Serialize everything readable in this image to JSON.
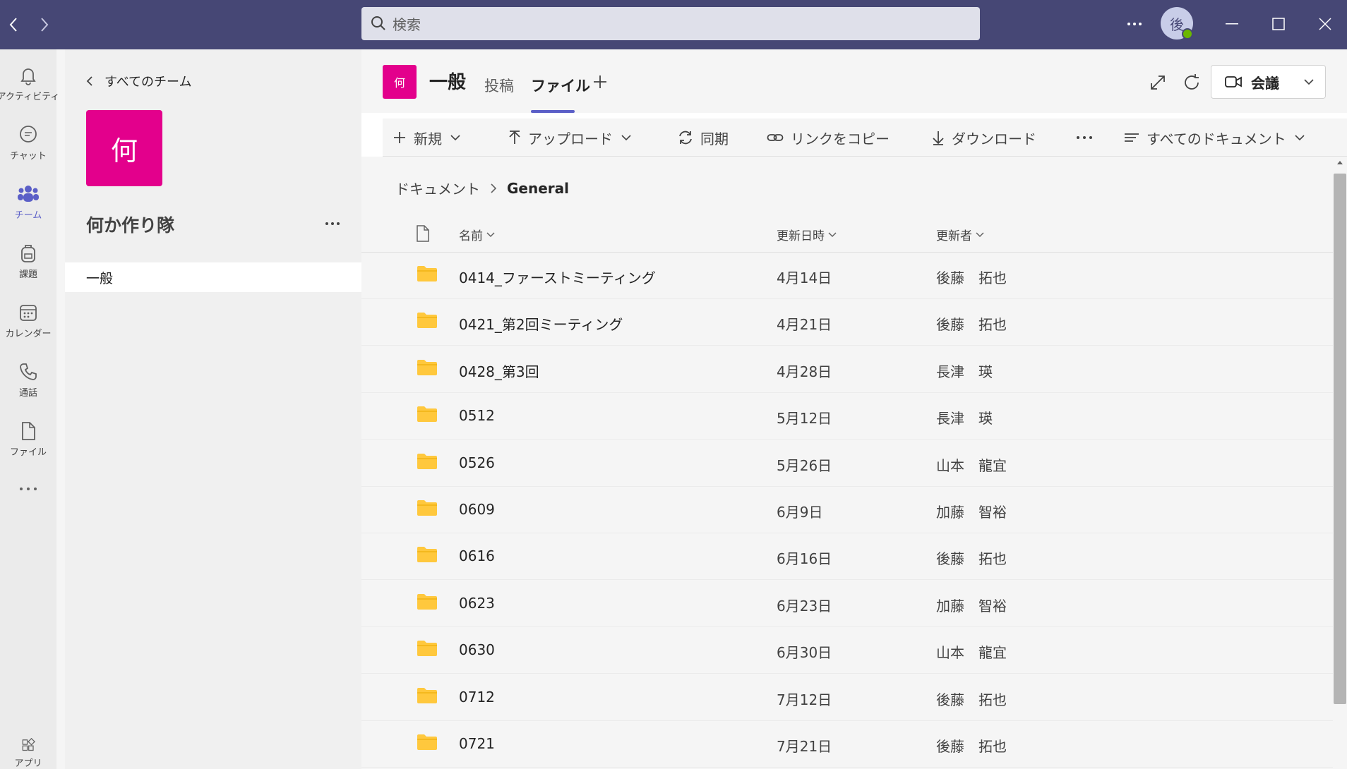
{
  "titlebar": {
    "search_placeholder": "検索",
    "avatar_initial": "後"
  },
  "rail": {
    "items": [
      {
        "label": "アクティビティ",
        "icon": "bell-icon"
      },
      {
        "label": "チャット",
        "icon": "chat-icon"
      },
      {
        "label": "チーム",
        "icon": "teams-icon"
      },
      {
        "label": "課題",
        "icon": "backpack-icon"
      },
      {
        "label": "カレンダー",
        "icon": "calendar-icon"
      },
      {
        "label": "通話",
        "icon": "phone-icon"
      },
      {
        "label": "ファイル",
        "icon": "file-icon"
      },
      {
        "label": "アプリ",
        "icon": "apps-icon"
      }
    ]
  },
  "team_panel": {
    "back_label": "すべてのチーム",
    "team_initial": "何",
    "team_name": "何か作り隊",
    "channels": [
      "一般"
    ]
  },
  "channel": {
    "initial": "何",
    "title": "一般",
    "tabs": [
      "投稿",
      "ファイル"
    ],
    "active_tab": "ファイル",
    "meet_label": "会議"
  },
  "commands": {
    "new": "新規",
    "upload": "アップロード",
    "sync": "同期",
    "copy_link": "リンクをコピー",
    "download": "ダウンロード",
    "view": "すべてのドキュメント"
  },
  "breadcrumb": {
    "root": "ドキュメント",
    "current": "General"
  },
  "columns": {
    "name": "名前",
    "modified": "更新日時",
    "modified_by": "更新者"
  },
  "files": [
    {
      "name": "0414_ファーストミーティング",
      "date": "4月14日",
      "user": "後藤　拓也"
    },
    {
      "name": "0421_第2回ミーティング",
      "date": "4月21日",
      "user": "後藤　拓也"
    },
    {
      "name": "0428_第3回",
      "date": "4月28日",
      "user": "長津　瑛"
    },
    {
      "name": "0512",
      "date": "5月12日",
      "user": "長津　瑛"
    },
    {
      "name": "0526",
      "date": "5月26日",
      "user": "山本　龍宜"
    },
    {
      "name": "0609",
      "date": "6月9日",
      "user": "加藤　智裕"
    },
    {
      "name": "0616",
      "date": "6月16日",
      "user": "後藤　拓也"
    },
    {
      "name": "0623",
      "date": "6月23日",
      "user": "加藤　智裕"
    },
    {
      "name": "0630",
      "date": "6月30日",
      "user": "山本　龍宜"
    },
    {
      "name": "0712",
      "date": "7月12日",
      "user": "後藤　拓也"
    },
    {
      "name": "0721",
      "date": "7月21日",
      "user": "後藤　拓也"
    }
  ],
  "colors": {
    "titlebar": "#464775",
    "accent": "#5b5fc7",
    "team_tile": "#e3008c",
    "folder": "#ffc83d"
  }
}
